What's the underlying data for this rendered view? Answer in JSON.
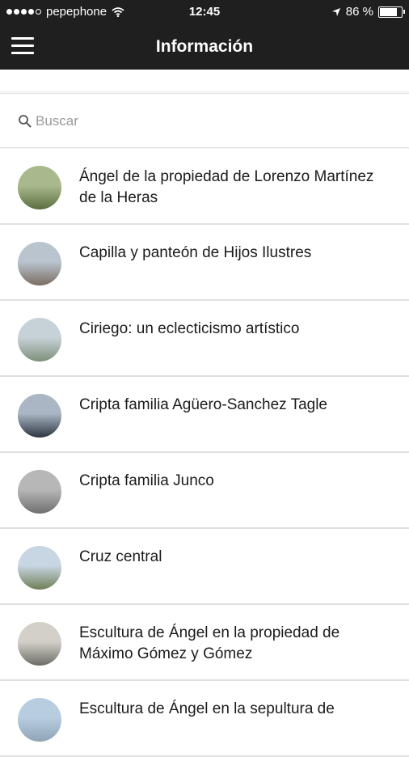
{
  "status_bar": {
    "carrier": "pepephone",
    "time": "12:45",
    "battery": "86 %",
    "battery_level": 0.86
  },
  "nav": {
    "title": "Información",
    "menu_icon": "hamburger-menu-icon"
  },
  "search": {
    "placeholder": "Buscar",
    "value": "",
    "icon": "search-icon"
  },
  "items": [
    {
      "label": "Ángel de la propiedad de Lorenzo Martínez de la Heras",
      "thumb_colors": [
        "#a9b98d",
        "#5c6e3f"
      ]
    },
    {
      "label": "Capilla y panteón de Hijos Ilustres",
      "thumb_colors": [
        "#b9c4cf",
        "#7a6d62"
      ]
    },
    {
      "label": "Ciriego: un eclecticismo artístico",
      "thumb_colors": [
        "#c7d2d8",
        "#7e8f7a"
      ]
    },
    {
      "label": "Cripta familia Agüero-Sanchez Tagle",
      "thumb_colors": [
        "#aab6c4",
        "#2d3540"
      ]
    },
    {
      "label": "Cripta familia Junco",
      "thumb_colors": [
        "#b7b7b7",
        "#6e6e6e"
      ]
    },
    {
      "label": "Cruz central",
      "thumb_colors": [
        "#c8d6e4",
        "#6f7f55"
      ]
    },
    {
      "label": "Escultura de Ángel en la propiedad de Máximo Gómez y Gómez",
      "thumb_colors": [
        "#d3d0c9",
        "#6d6d67"
      ]
    },
    {
      "label": "Escultura de Ángel en la sepultura de",
      "thumb_colors": [
        "#b8cde0",
        "#8fa4b6"
      ]
    }
  ]
}
